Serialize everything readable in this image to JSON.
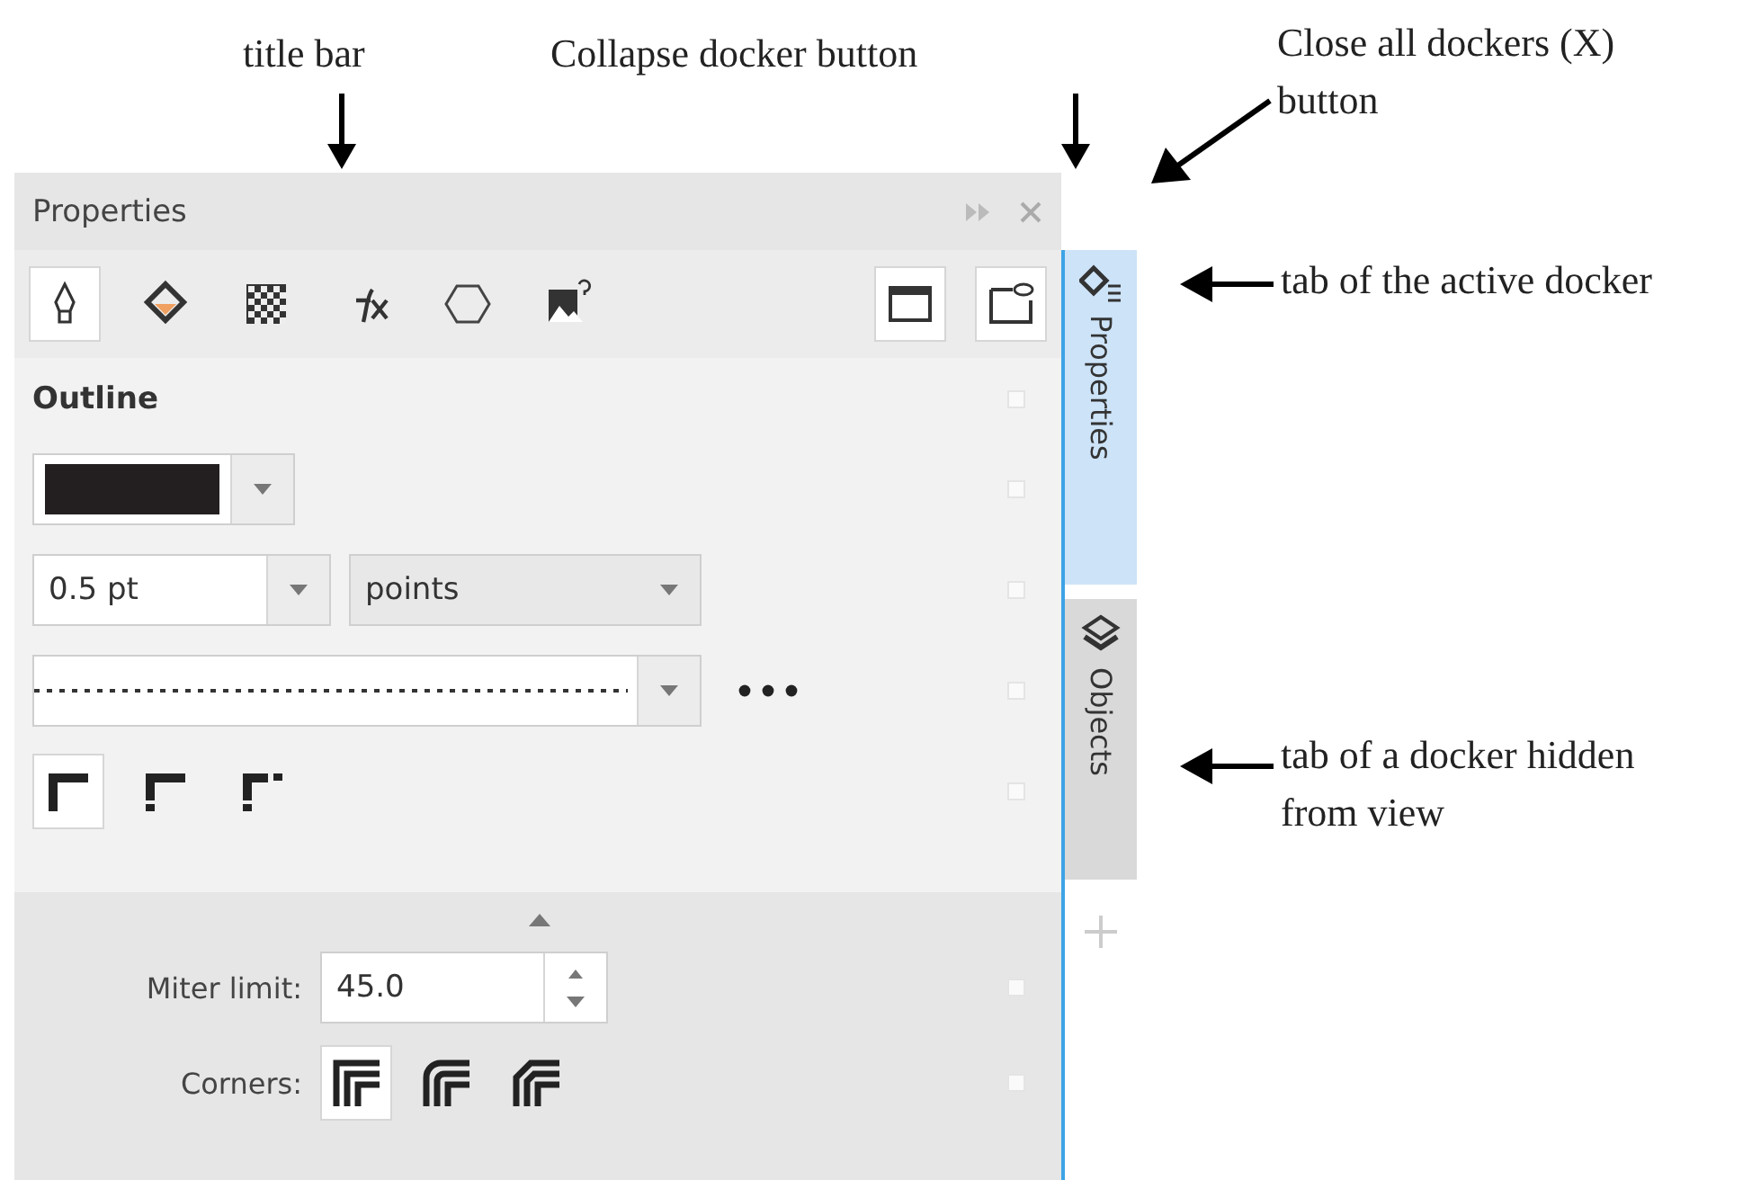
{
  "annotations": [
    {
      "kind": "down",
      "text": "title bar"
    },
    {
      "kind": "down",
      "text": "Collapse docker button"
    },
    {
      "kind": "diagonal",
      "text": "Close all dockers (X) button"
    },
    {
      "kind": "left",
      "text": "tab of the active docker"
    },
    {
      "kind": "left",
      "text": "tab of a docker hidden from view"
    }
  ],
  "docker": {
    "title": "Properties",
    "toolbar": [
      {
        "kind": "pen",
        "selected": true
      },
      {
        "kind": "fill",
        "selected": false
      },
      {
        "kind": "checker",
        "selected": false
      },
      {
        "kind": "fx",
        "selected": false
      },
      {
        "kind": "hexagon",
        "selected": false
      },
      {
        "kind": "image",
        "selected": false
      }
    ],
    "toolbar_right": [
      {
        "kind": "frame",
        "selected": true
      },
      {
        "kind": "frame-eye",
        "selected": true
      }
    ],
    "section_title": "Outline",
    "width_field": {
      "value": "0.5 pt"
    },
    "units": {
      "value": "points"
    },
    "line_caps": [
      {
        "kind": "square",
        "selected": true
      },
      {
        "kind": "round",
        "selected": false
      },
      {
        "kind": "ext",
        "selected": false
      }
    ],
    "miter": {
      "label": "Miter limit:",
      "value": "45.0"
    },
    "corners": {
      "label": "Corners:",
      "options": [
        {
          "kind": "miter",
          "selected": true
        },
        {
          "kind": "round",
          "selected": false
        },
        {
          "kind": "bevel",
          "selected": false
        }
      ]
    }
  },
  "side_tabs": [
    {
      "label": "Properties",
      "selected": true
    },
    {
      "label": "Objects",
      "selected": false
    }
  ]
}
